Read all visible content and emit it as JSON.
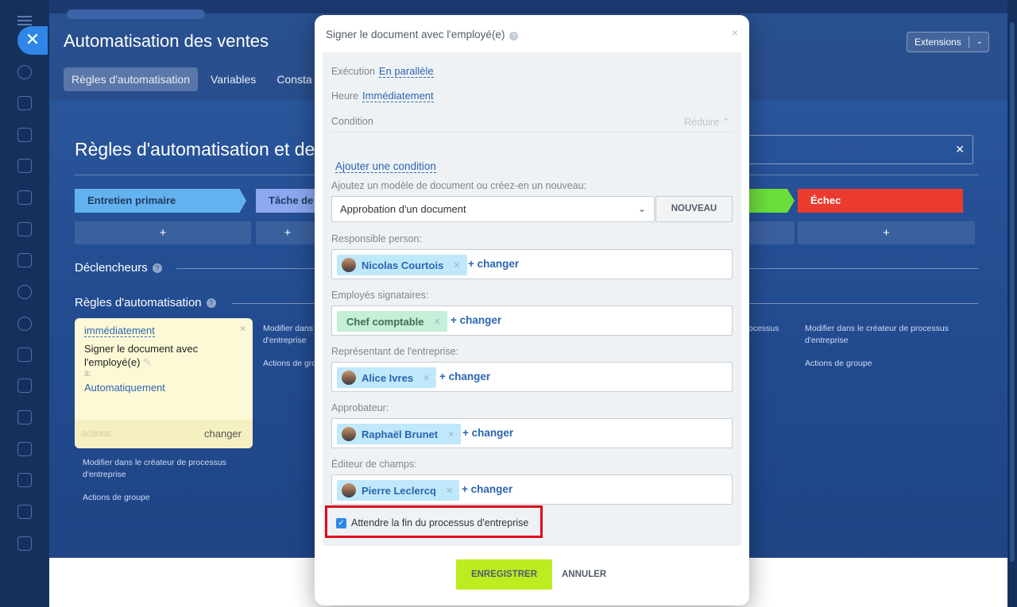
{
  "app": {
    "page_title": "Automatisation des ventes",
    "extensions_label": "Extensions",
    "tabs": [
      "Règles d'automatisation",
      "Variables",
      "Consta"
    ]
  },
  "main": {
    "title": "Règles d'automatisation et de",
    "stages": [
      {
        "label": "Entretien primaire",
        "color": "#63b2f0"
      },
      {
        "label": "Tâche de ",
        "color": "#8da8f0"
      },
      {
        "label": "",
        "color": "#6bde3c"
      },
      {
        "label": "Échec",
        "color": "#eb3b2e"
      }
    ],
    "add_symbol": "+",
    "triggers_label": "Déclencheurs",
    "rules_label": "Règles d'automatisation",
    "help_glyph": "?",
    "rule_card": {
      "when": "immédiatement",
      "title": "Signer le document avec l'employé(e)",
      "to_label": "à:",
      "target": "Automatiquement",
      "actions": "actions",
      "change": "changer",
      "close": "×"
    },
    "links": {
      "modify_designer": "Modifier dans le créateur de processus d'entreprise",
      "group_actions": "Actions de groupe",
      "col2_modify": "Modifier dans d'entreprise",
      "col2_actions": "Actions de gro",
      "col3_processus": "ocessus"
    }
  },
  "dialog": {
    "title": "Signer le document avec l'employé(e)",
    "close": "×",
    "execution_label": "Exécution",
    "execution_value": "En parallèle",
    "time_label": "Heure",
    "time_value": "Immédiatement",
    "condition_label": "Condition",
    "reduce_label": "Réduire",
    "add_condition": "Ajouter une condition",
    "template_prompt": "Ajoutez un modèle de document ou créez-en un nouveau:",
    "template_value": "Approbation d'un document",
    "new_button": "NOUVEAU",
    "fields": [
      {
        "label": "Responsible person:",
        "chip": "Nicolas Courtois",
        "change": "+ changer"
      },
      {
        "label": "Employés signataires:",
        "chip": "Chef comptable",
        "change": "+ changer"
      },
      {
        "label": "Représentant de l'entreprise:",
        "chip": "Alice Ivres",
        "change": "+ changer"
      },
      {
        "label": "Approbateur:",
        "chip": "Raphaël Brunet",
        "change": "+ changer"
      },
      {
        "label": "Éditeur de champs:",
        "chip": "Pierre Leclercq",
        "change": "+ changer"
      }
    ],
    "wait_checkbox": {
      "label": "Attendre la fin du processus d'entreprise",
      "checked": true
    },
    "save_button": "ENREGISTRER",
    "cancel_button": "ANNULER"
  }
}
